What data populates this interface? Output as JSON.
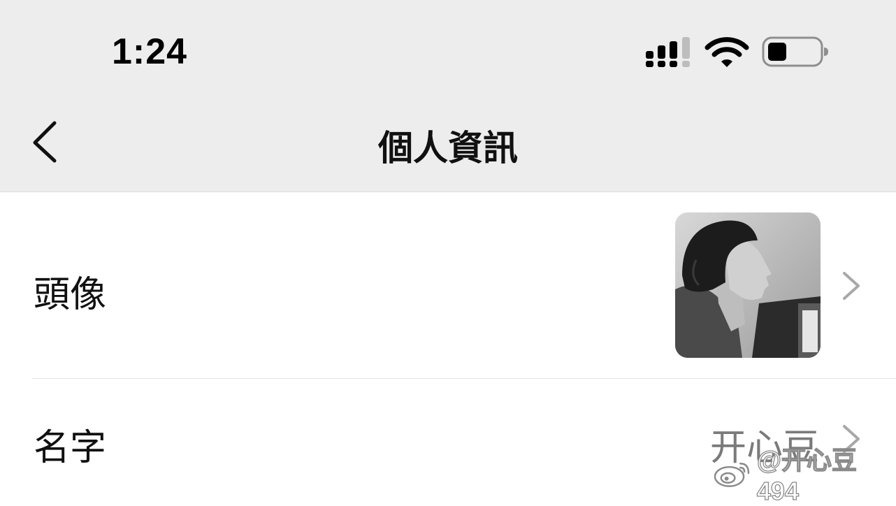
{
  "status_bar": {
    "time": "1:24",
    "icons": [
      "cellular-signal-icon",
      "wifi-icon",
      "battery-icon"
    ],
    "battery_level": 0.3
  },
  "nav": {
    "back_icon": "chevron-left-icon",
    "title": "個人資訊"
  },
  "rows": {
    "avatar": {
      "label": "頭像",
      "chevron_icon": "chevron-right-icon"
    },
    "name": {
      "label": "名字",
      "value": "开心豆",
      "chevron_icon": "chevron-right-icon"
    }
  },
  "watermark": {
    "icon": "weibo-logo-icon",
    "text": "@开心豆494"
  },
  "colors": {
    "header_bg": "#ededed",
    "row_bg": "#ffffff",
    "secondary_text": "#7a7a7a",
    "chevron": "#a8a8a8"
  }
}
